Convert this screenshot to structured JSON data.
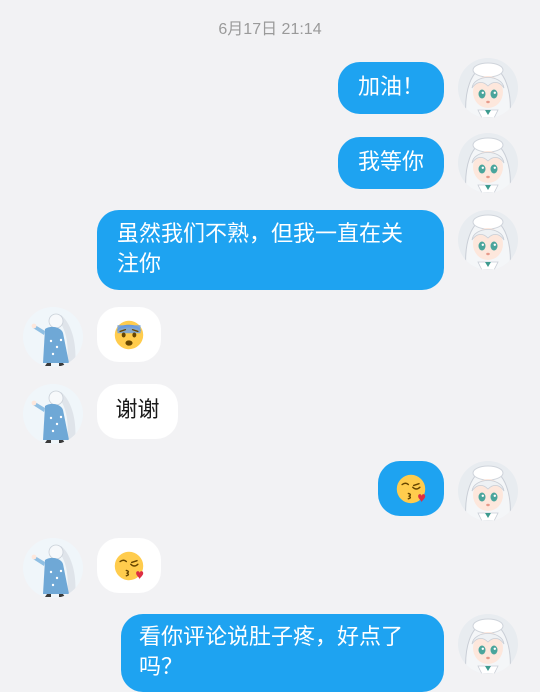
{
  "chat": {
    "timestamp": "6月17日 21:14",
    "messages": [
      {
        "direction": "out",
        "text": "加油！"
      },
      {
        "direction": "out",
        "text": "我等你"
      },
      {
        "direction": "out",
        "text": "虽然我们不熟，但我一直在关注你"
      },
      {
        "direction": "in",
        "emoji": "fearful-face"
      },
      {
        "direction": "in",
        "text": "谢谢"
      },
      {
        "direction": "out",
        "emoji": "face-blowing-kiss"
      },
      {
        "direction": "in",
        "emoji": "face-blowing-kiss"
      },
      {
        "direction": "out",
        "text": "看你评论说肚子疼，好点了吗？"
      }
    ]
  },
  "colors": {
    "background": "#f2f2f4",
    "outgoing_bubble": "#1ea3f1",
    "incoming_bubble": "#ffffff",
    "timestamp": "#9a9a9a"
  }
}
